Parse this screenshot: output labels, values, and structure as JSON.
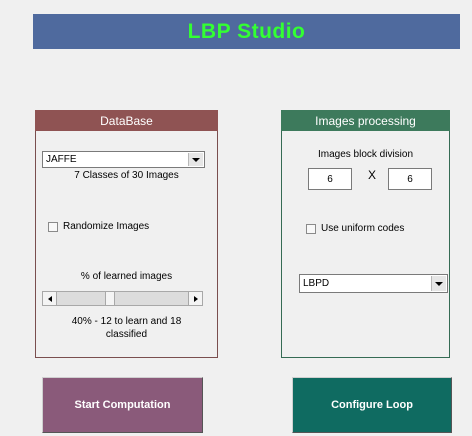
{
  "app": {
    "title": "LBP Studio",
    "title_color": "#33ff33",
    "banner_color": "#4f6a9e"
  },
  "database": {
    "header": "DataBase",
    "dataset_select": {
      "value": "JAFFE"
    },
    "dataset_info": "7 Classes of 30 Images",
    "randomize_label": "Randomize Images",
    "randomize_checked": false,
    "learned_label": "% of learned images",
    "learned_percent": 40,
    "learned_info_line1": "40% - 12 to learn and 18",
    "learned_info_line2": "classified"
  },
  "processing": {
    "header": "Images processing",
    "block_division_label": "Images block division",
    "block_rows": "6",
    "block_x": "X",
    "block_cols": "6",
    "uniform_label": "Use uniform codes",
    "uniform_checked": false,
    "method_select": {
      "value": "LBPD"
    }
  },
  "buttons": {
    "start": {
      "label": "Start Computation",
      "color": "#8a5a7a"
    },
    "configure": {
      "label": "Configure Loop",
      "color": "#0f6b61"
    }
  }
}
